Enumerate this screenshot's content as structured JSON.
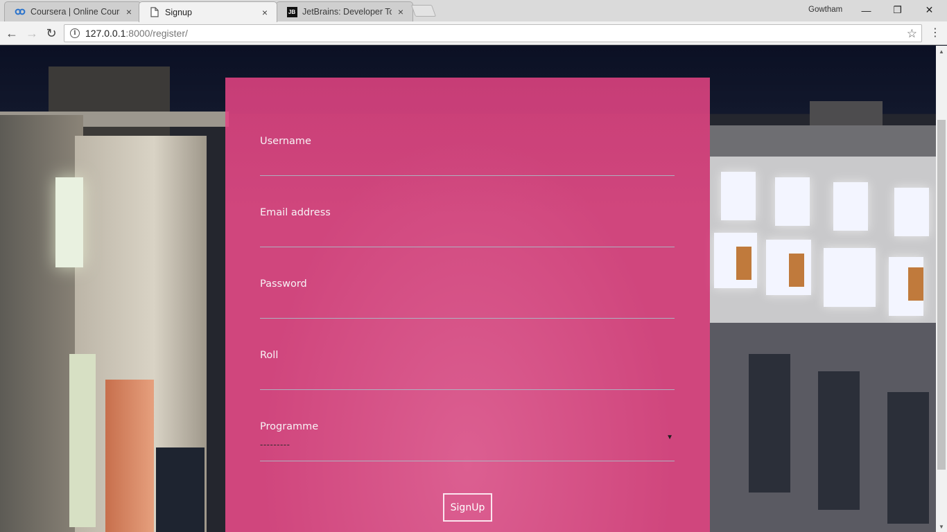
{
  "browser": {
    "tabs": [
      {
        "title": "Coursera | Online Courses",
        "favicon": "coursera-logo-icon",
        "active": false
      },
      {
        "title": "Signup",
        "favicon": "page-icon",
        "active": true
      },
      {
        "title": "JetBrains: Developer Tools",
        "favicon": "jetbrains-logo-icon",
        "active": false
      }
    ],
    "jetbrains_badge": "JB",
    "user": "Gowtham",
    "url_host": "127.0.0.1",
    "url_rest": ":8000/register/",
    "icons": {
      "close": "×",
      "back": "←",
      "forward": "→",
      "reload": "↻",
      "info": "i",
      "star": "☆",
      "menu": "⋮",
      "minimize": "—",
      "restore": "❐",
      "window_close": "✕",
      "scroll_up": "▲",
      "scroll_down": "▼"
    }
  },
  "form": {
    "username_label": "Username",
    "email_label": "Email address",
    "password_label": "Password",
    "roll_label": "Roll",
    "programme_label": "Programme",
    "programme_selected": "---------",
    "select_arrow": "▼",
    "submit_label": "SignUp",
    "panel_color": "#ec4c8a"
  }
}
